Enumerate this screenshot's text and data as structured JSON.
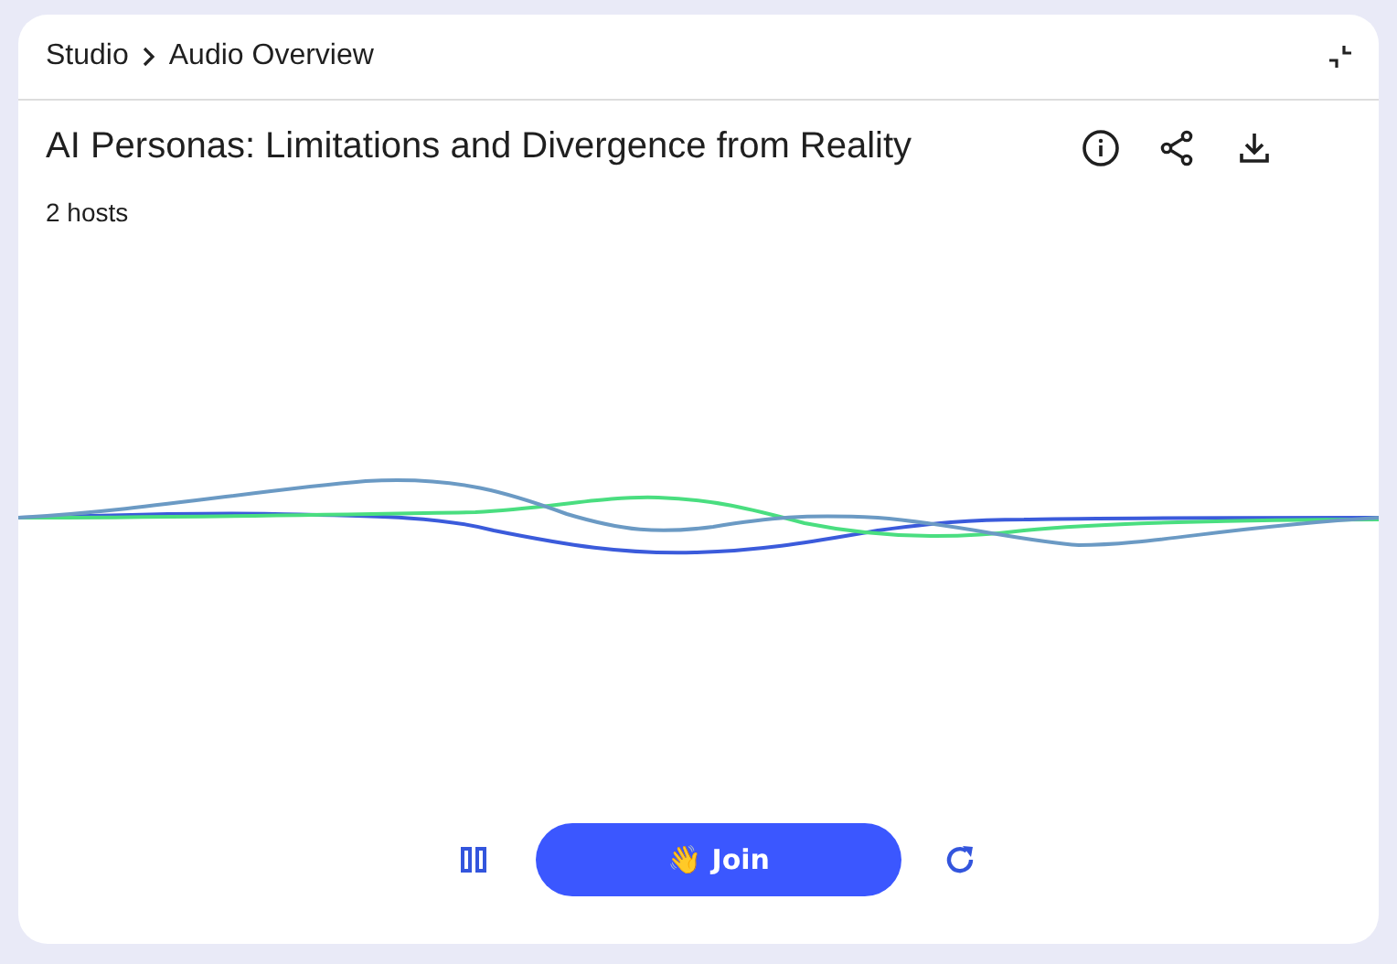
{
  "breadcrumb": [
    "Studio",
    "Audio Overview"
  ],
  "title": "AI Personas: Limitations and Divergence from Reality",
  "subtitle": "2 hosts",
  "controls": {
    "playing": true,
    "join_label": "👋 Join"
  }
}
